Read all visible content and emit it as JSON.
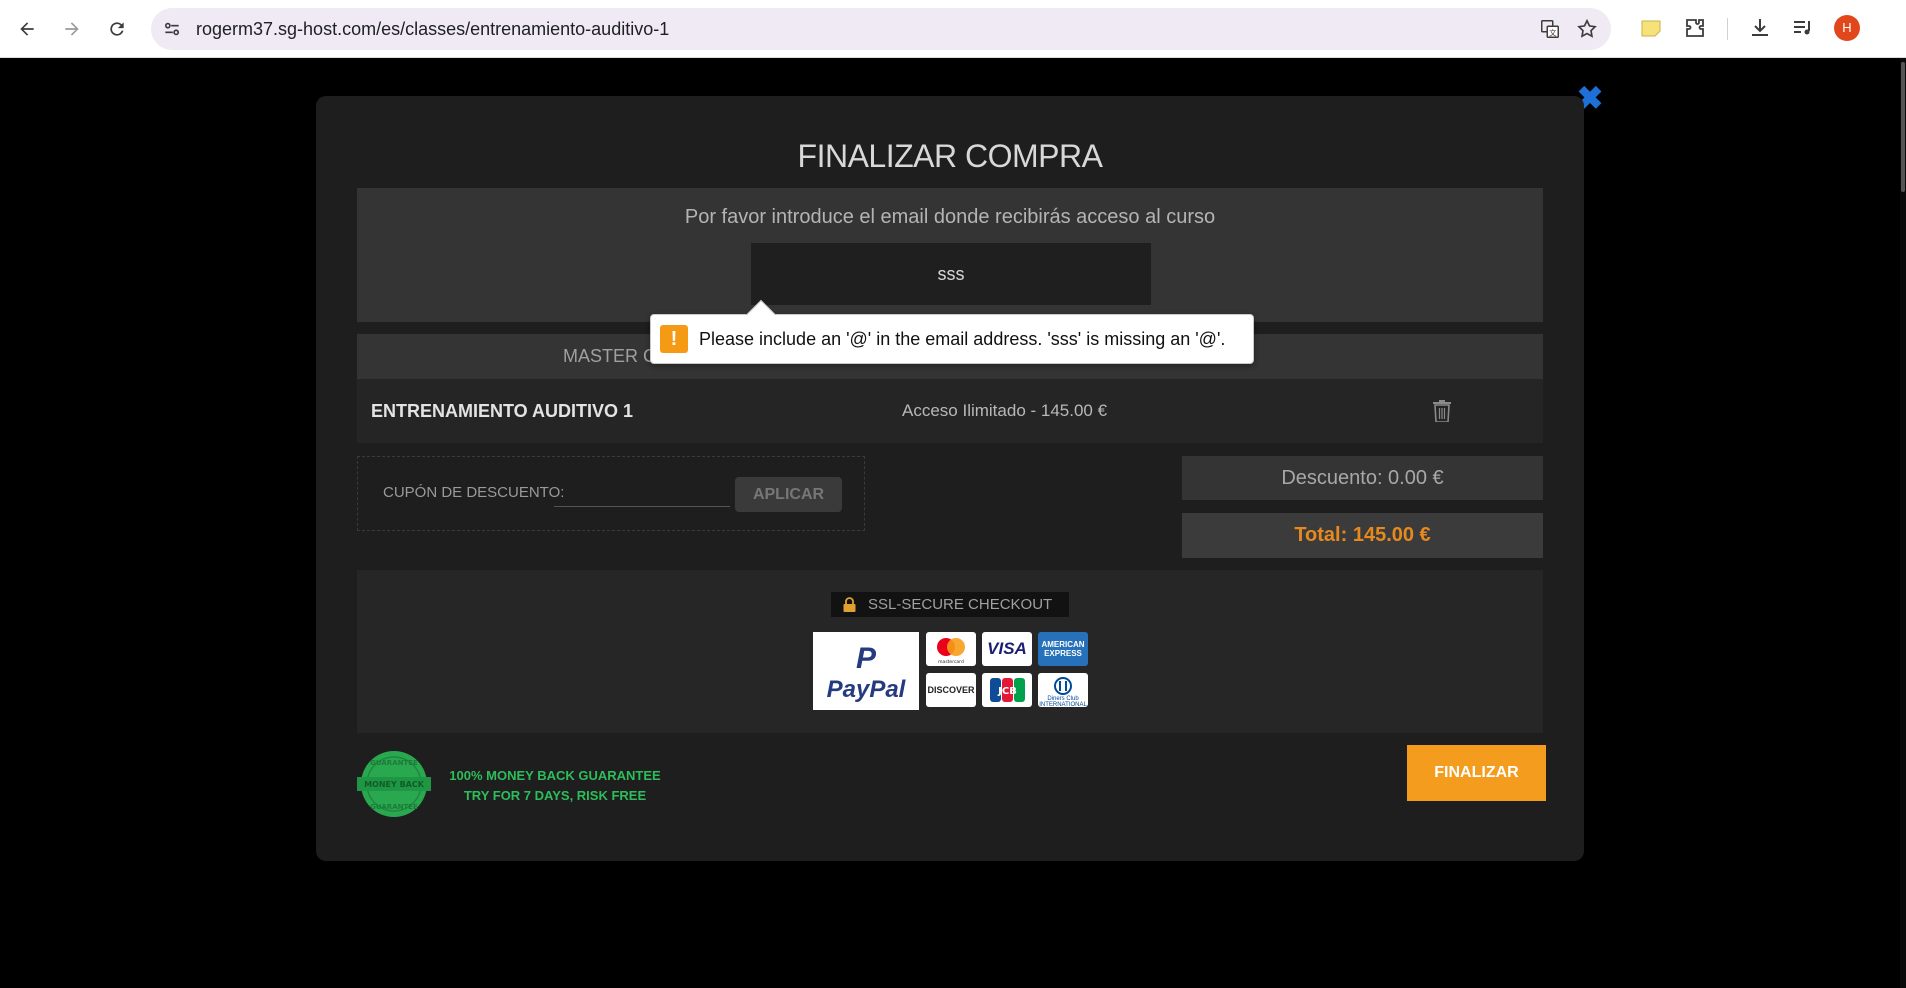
{
  "browser": {
    "url": "rogerm37.sg-host.com/es/classes/entrenamiento-auditivo-1",
    "profile_initial": "H",
    "profile_color": "#e2471b"
  },
  "modal": {
    "close_symbol": "✖",
    "title": "FINALIZAR COMPRA",
    "email_prompt": "Por favor introduce el email donde recibirás acceso al curso",
    "email_value": "sss",
    "course_header": "MASTER C",
    "course_name": "ENTRENAMIENTO AUDITIVO 1",
    "course_price": "Acceso Ilimitado - 145.00 €",
    "coupon_label": "CUPÓN DE DESCUENTO:",
    "coupon_value": "",
    "apply_label": "APLICAR",
    "discount": "Descuento: 0.00 €",
    "total": "Total: 145.00 €",
    "ssl_label": "SSL-SECURE CHECKOUT",
    "payment_methods": {
      "paypal": "PayPal",
      "mastercard": "mastercard",
      "visa": "VISA",
      "amex": "AMERICAN EXPRESS",
      "discover": "DISCOVER",
      "jcb": "JCB",
      "diners": "Diners Club INTERNATIONAL"
    },
    "seal_text_top": "GUARANTEE",
    "seal_text_middle": "MONEY BACK",
    "seal_text_bottom": "GUARANTEE",
    "guarantee_line1": "100% MONEY BACK GUARANTEE",
    "guarantee_line2": "TRY FOR 7 DAYS, RISK FREE",
    "finalize_label": "FINALIZAR"
  },
  "validation_tooltip": {
    "icon": "!",
    "message": "Please include an '@' in the email address. 'sss' is missing an '@'."
  },
  "colors": {
    "accent": "#f39c1e",
    "total": "#e68a1f",
    "guarantee_green": "#2dbd5a",
    "close_blue": "#1e6fd6",
    "warning": "#f49a15"
  }
}
